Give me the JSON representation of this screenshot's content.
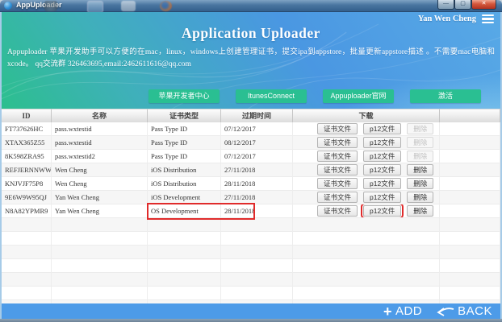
{
  "titlebar": {
    "app_title": "AppUploader",
    "controls": {
      "minimize": "—",
      "maximize": "▢",
      "close": "✕"
    }
  },
  "header": {
    "user_name": "Yan Wen Cheng",
    "title": "Application Uploader",
    "description": "Appuploader 苹果开发助手可以方便的在mac，linux，windows上创建管理证书，提交ipa到appstore，批量更新appstore描述 。不需要mac电脑和xcode。 qq交流群 326463695,email:2462611616@qq.com",
    "nav_buttons": [
      {
        "id": "apple-dev-center",
        "label": "苹果开发者中心"
      },
      {
        "id": "itunes-connect",
        "label": "ItunesConnect"
      },
      {
        "id": "appuploader-site",
        "label": "Appuploader官网"
      },
      {
        "id": "activate",
        "label": "激活"
      }
    ]
  },
  "table": {
    "columns": [
      "ID",
      "名称",
      "证书类型",
      "过期时间",
      "下载",
      ""
    ],
    "action_labels": {
      "cert": "证书文件",
      "p12": "p12文件",
      "delete": "删除"
    },
    "rows": [
      {
        "id": "FT737626HC",
        "name": "pass.wxtestid",
        "type": "Pass Type ID",
        "expiry": "07/12/2017",
        "delete_enabled": false,
        "highlight_cells": false,
        "highlight_p12": false
      },
      {
        "id": "XTAX365Z55",
        "name": "pass.wxtestid",
        "type": "Pass Type ID",
        "expiry": "08/12/2017",
        "delete_enabled": false,
        "highlight_cells": false,
        "highlight_p12": false
      },
      {
        "id": "8K598ZRA95",
        "name": "pass.wxtestid2",
        "type": "Pass Type ID",
        "expiry": "07/12/2017",
        "delete_enabled": false,
        "highlight_cells": false,
        "highlight_p12": false
      },
      {
        "id": "REFJERNNWW",
        "name": "Wen Cheng",
        "type": "iOS Distribution",
        "expiry": "27/11/2018",
        "delete_enabled": true,
        "highlight_cells": false,
        "highlight_p12": false
      },
      {
        "id": "KNJVJF75P8",
        "name": "Wen Cheng",
        "type": "iOS Distribution",
        "expiry": "28/11/2018",
        "delete_enabled": true,
        "highlight_cells": false,
        "highlight_p12": false
      },
      {
        "id": "9E6W9W95QJ",
        "name": "Yan Wen Cheng",
        "type": "iOS Development",
        "expiry": "27/11/2018",
        "delete_enabled": true,
        "highlight_cells": false,
        "highlight_p12": false
      },
      {
        "id": "N8A82YPMR9",
        "name": "Yan Wen Cheng",
        "type": "OS Development",
        "expiry": "28/11/2018",
        "delete_enabled": true,
        "highlight_cells": true,
        "highlight_p12": true
      }
    ],
    "empty_filler_rows": 7
  },
  "footer": {
    "add": "ADD",
    "back": "BACK"
  },
  "colors": {
    "button_green": "#2abf92",
    "footer_blue": "#4d9be8",
    "highlight_red": "#e02b2b",
    "banner_blue": "#4a97e2",
    "banner_green": "#2cbf8e"
  }
}
